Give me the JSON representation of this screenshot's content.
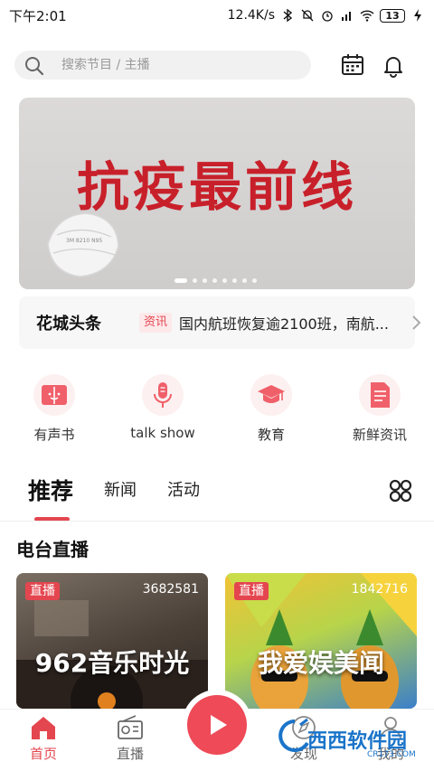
{
  "status_bar": {
    "time": "下午2:01",
    "network_speed": "12.4K/s",
    "battery": "13"
  },
  "search": {
    "placeholder": "搜索节目 / 主播"
  },
  "banner": {
    "title": "抗疫最前线",
    "mask_print": "3M 8210 N95",
    "slide_count": 8,
    "active_slide": 1
  },
  "headline": {
    "logo": "花城头条",
    "tag": "资讯",
    "text": "国内航班恢复逾2100班，南航..."
  },
  "categories": [
    {
      "label": "有声书",
      "icon": "book-icon"
    },
    {
      "label": "talk show",
      "icon": "microphone-icon"
    },
    {
      "label": "教育",
      "icon": "graduation-cap-icon"
    },
    {
      "label": "新鲜资讯",
      "icon": "news-document-icon"
    }
  ],
  "tabs": [
    {
      "label": "推荐",
      "active": true
    },
    {
      "label": "新闻",
      "active": false
    },
    {
      "label": "活动",
      "active": false
    }
  ],
  "section": {
    "title": "电台直播"
  },
  "live_cards": [
    {
      "badge": "直播",
      "count": "3682581",
      "name": "962音乐时光"
    },
    {
      "badge": "直播",
      "count": "1842716",
      "name": "我爱娱美闻"
    }
  ],
  "bottom_nav": [
    {
      "label": "首页",
      "icon": "home-icon",
      "active": true
    },
    {
      "label": "直播",
      "icon": "radio-icon",
      "active": false
    },
    {
      "label": "发现",
      "icon": "discover-icon",
      "active": false
    },
    {
      "label": "我的",
      "icon": "profile-icon",
      "active": false
    }
  ],
  "watermark": {
    "text": "西西软件园",
    "sub": "CR173.COM"
  },
  "colors": {
    "accent": "#e4464f",
    "play_button": "#ee4a57",
    "banner_title": "#c8202a",
    "search_bg": "#f1f1f1"
  }
}
